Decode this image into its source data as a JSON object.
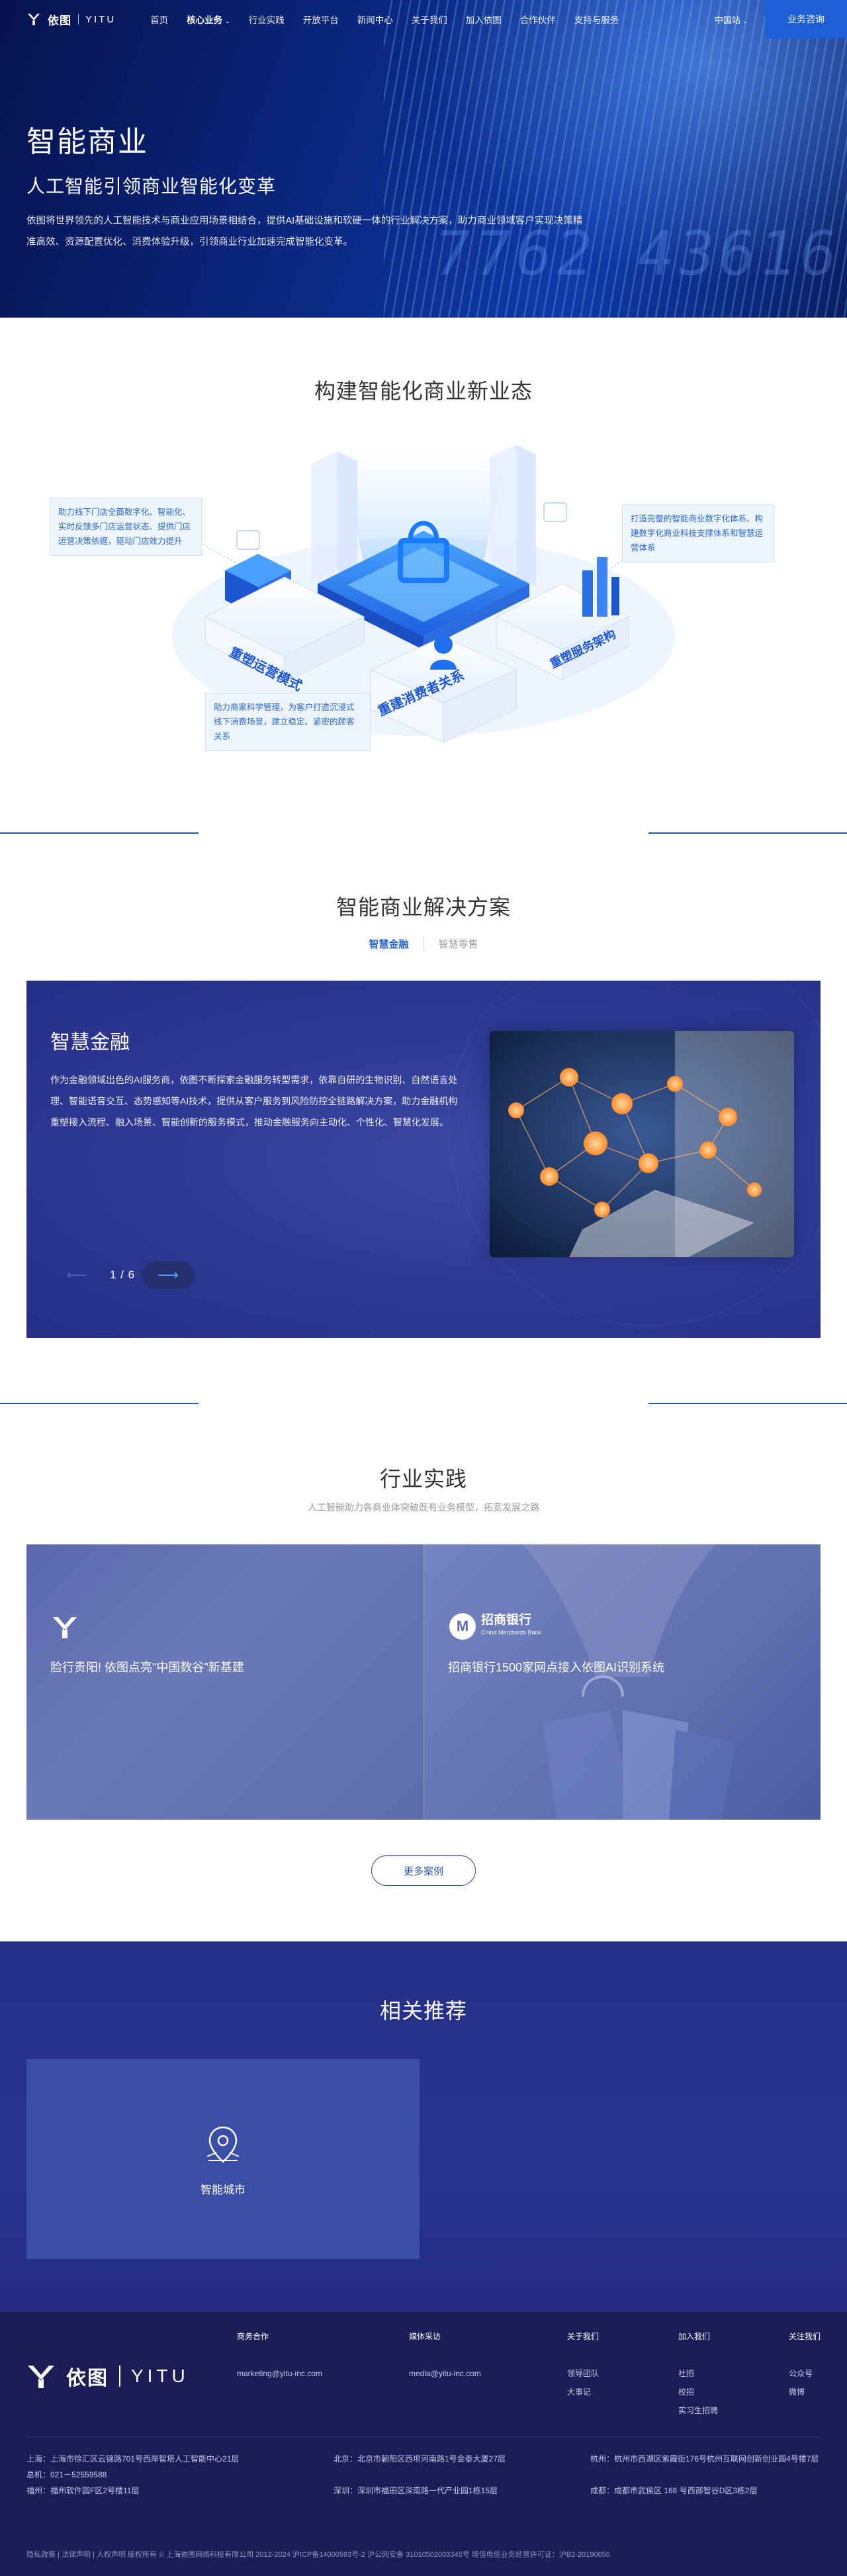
{
  "nav": {
    "logo_cn": "依图",
    "logo_en": "YITU",
    "items": [
      "首页",
      "核心业务",
      "行业实践",
      "开放平台",
      "新闻中心",
      "关于我们",
      "加入依图",
      "合作伙伴",
      "支持与服务"
    ],
    "region": "中国站",
    "cta": "业务咨询"
  },
  "hero": {
    "title": "智能商业",
    "subtitle": "人工智能引领商业智能化变革",
    "desc": "依图将世界领先的人工智能技术与商业应用场景相结合，提供AI基础设施和软硬一体的行业解决方案，助力商业领域客户实现决策精准高效、资源配置优化、消费体验升级，引领商业行业加速完成智能化变革。",
    "digits": "7762 43616"
  },
  "sec1": {
    "title": "构建智能化商业新业态",
    "callouts": [
      "助力线下门店全面数字化、智能化、实时反馈多门店运营状态、提供门店运营决策依据，驱动门店效力提升",
      "打造完整的智能商业数字化体系、构建数字化商业科技支撑体系和智慧运营体系",
      "助力商家科学管理，为客户打造沉浸式线下消费场景，建立稳定、紧密的顾客关系"
    ],
    "labels": [
      "重塑运营模式",
      "重建消费者关系",
      "重塑服务架构"
    ]
  },
  "sec2": {
    "title": "智能商业解决方案",
    "tabs": [
      "智慧金融",
      "智慧零售"
    ],
    "card": {
      "title": "智慧金融",
      "desc": "作为金融领域出色的AI服务商，依图不断探索金融服务转型需求，依靠自研的生物识别、自然语言处理、智能语音交互、态势感知等AI技术，提供从客户服务到风险防控全链路解决方案，助力金融机构重塑接入流程、融入场景、智能创新的服务模式，推动金融服务向主动化、个性化、智慧化发展。",
      "page": "1 / 6"
    }
  },
  "sec3": {
    "title": "行业实践",
    "subtitle": "人工智能助力各商业体突破既有业务模型，拓宽发展之路",
    "cases": [
      {
        "title": "脸行贵阳! 依图点亮\"中国数谷\"新基建"
      },
      {
        "title": "招商银行1500家网点接入依图AI识别系统",
        "logo_cn": "招商银行",
        "logo_en": "China Merchants Bank"
      }
    ],
    "more": "更多案例"
  },
  "sec4": {
    "title": "相关推荐",
    "card_label": "智能城市"
  },
  "footer": {
    "logo_cn": "依图",
    "logo_en": "YITU",
    "cols": [
      {
        "h": "商务合作",
        "v": [
          "marketing@yitu-inc.com"
        ]
      },
      {
        "h": "媒体采访",
        "v": [
          "media@yitu-inc.com"
        ]
      },
      {
        "h": "关于我们",
        "v": [
          "领导团队",
          "大事记"
        ]
      },
      {
        "h": "加入我们",
        "v": [
          "社招",
          "校招",
          "实习生招聘"
        ]
      },
      {
        "h": "关注我们",
        "v": [
          "公众号",
          "微博"
        ]
      }
    ],
    "addr_left": [
      "上海：上海市徐汇区云锦路701号西岸智塔人工智能中心21层",
      "总机：021－52559588",
      "福州：福州软件园F区2号楼11层"
    ],
    "addr_mid": [
      "北京：北京市朝阳区西坝河南路1号金泰大厦27层",
      "深圳：深圳市福田区深南路一代产业园1栋15层"
    ],
    "addr_right": [
      "杭州：杭州市西湖区紫霞街176号杭州互联网创新创业园4号楼7层",
      "成都：成都市武侯区 166 号西部智谷D区3栋2层"
    ],
    "bottom": "隐私政策 | 法律声明 | 人权声明  版权所有 © 上海依图网络科技有限公司 2012-2024 沪ICP备14000593号-2  沪公网安备 31010502003345号  增值电信业务经营许可证：沪B2-20190650"
  }
}
